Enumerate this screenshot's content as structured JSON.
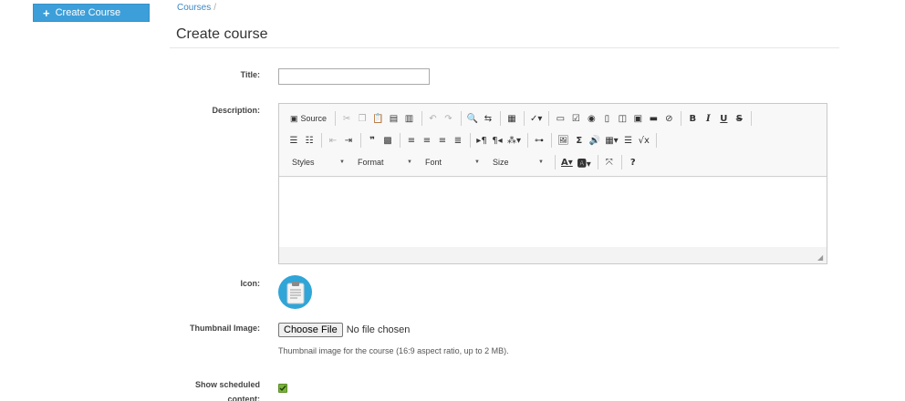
{
  "sidebar": {
    "create_button": {
      "icon": "plus-icon",
      "label": "Create Course"
    }
  },
  "breadcrumb": {
    "items": [
      "Courses"
    ],
    "separator": "/"
  },
  "page": {
    "title": "Create course"
  },
  "form": {
    "title": {
      "label": "Title:",
      "value": ""
    },
    "description": {
      "label": "Description:",
      "toolbar": {
        "source_label": "Source",
        "styles_label": "Styles",
        "format_label": "Format",
        "font_label": "Font",
        "size_label": "Size",
        "help_label": "?"
      }
    },
    "icon": {
      "label": "Icon:",
      "icon": "clipboard-icon",
      "color": "#2fa5d8"
    },
    "thumbnail": {
      "label": "Thumbnail Image:",
      "button_label": "Choose File",
      "status": "No file chosen",
      "help": "Thumbnail image for the course (16:9 aspect ratio, up to 2 MB)."
    },
    "show_scheduled": {
      "label_line1": "Show scheduled",
      "label_line2": "content:",
      "checked": true
    }
  },
  "colors": {
    "accent": "#3d9fd9",
    "link": "#3d87c4",
    "checkbox": "#7ab33b"
  }
}
